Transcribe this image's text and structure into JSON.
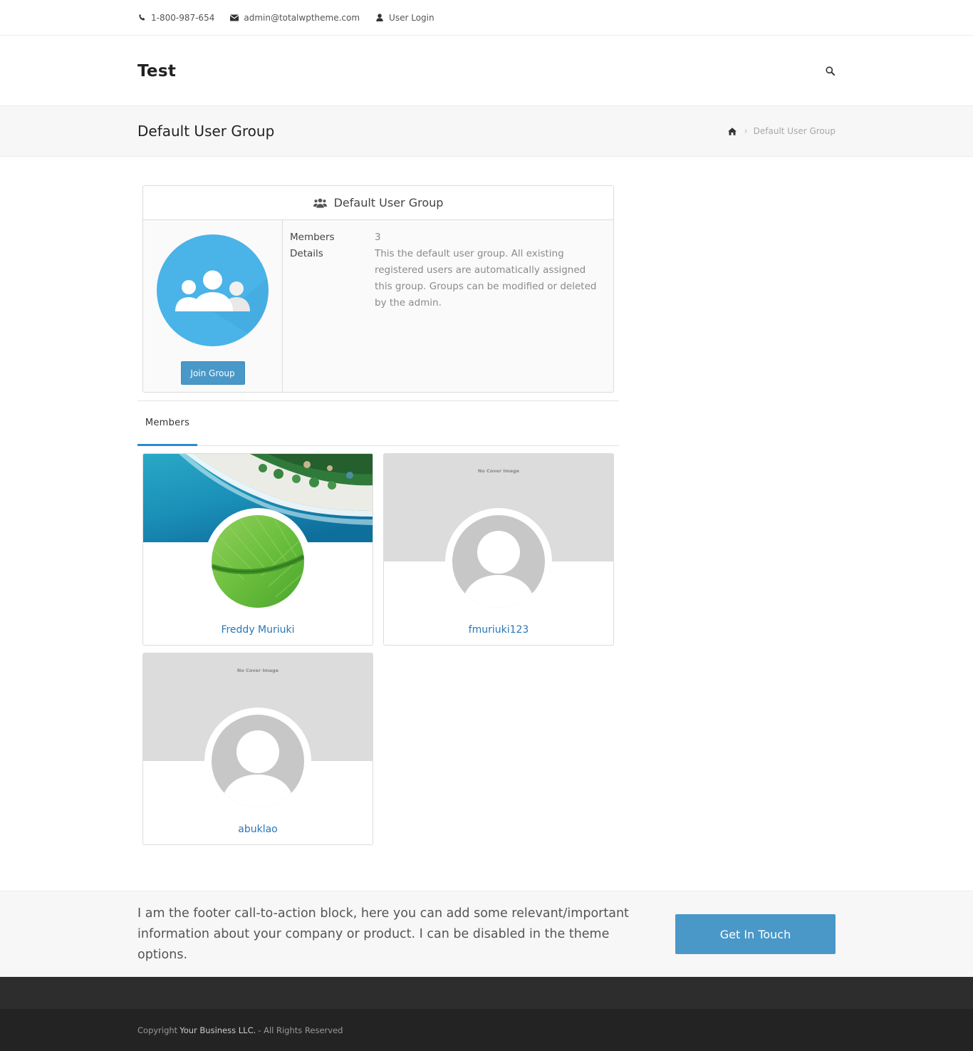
{
  "topbar": {
    "phone": "1-800-987-654",
    "email": "admin@totalwptheme.com",
    "login": "User Login"
  },
  "header": {
    "logo": "Test"
  },
  "titlebar": {
    "title": "Default User Group",
    "breadcrumb_current": "Default User Group"
  },
  "group": {
    "heading": "Default User Group",
    "join_label": "Join Group",
    "members_label": "Members",
    "members_value": "3",
    "details_label": "Details",
    "details_value": "This the default user group. All existing registered users are automatically assigned this group. Groups can be modified or deleted by the admin."
  },
  "tabs": {
    "members": "Members"
  },
  "members": [
    {
      "name": "Freddy Muriuki",
      "cover": "photo"
    },
    {
      "name": "fmuriuki123",
      "cover": "none",
      "cover_text": "No Cover Image"
    },
    {
      "name": "abuklao",
      "cover": "none",
      "cover_text": "No Cover Image"
    }
  ],
  "cta": {
    "text": "I am the footer call-to-action block, here you can add some relevant/important information about your company or product. I can be disabled in the theme options.",
    "button": "Get In Touch"
  },
  "footer": {
    "copyright_prefix": "Copyright",
    "business": "Your Business LLC.",
    "suffix": "- All Rights Reserved"
  },
  "colors": {
    "accent": "#4a98c8",
    "link": "#2a76b5",
    "tab_underline": "#2c8ad2",
    "group_avatar": "#4ab3e8"
  }
}
